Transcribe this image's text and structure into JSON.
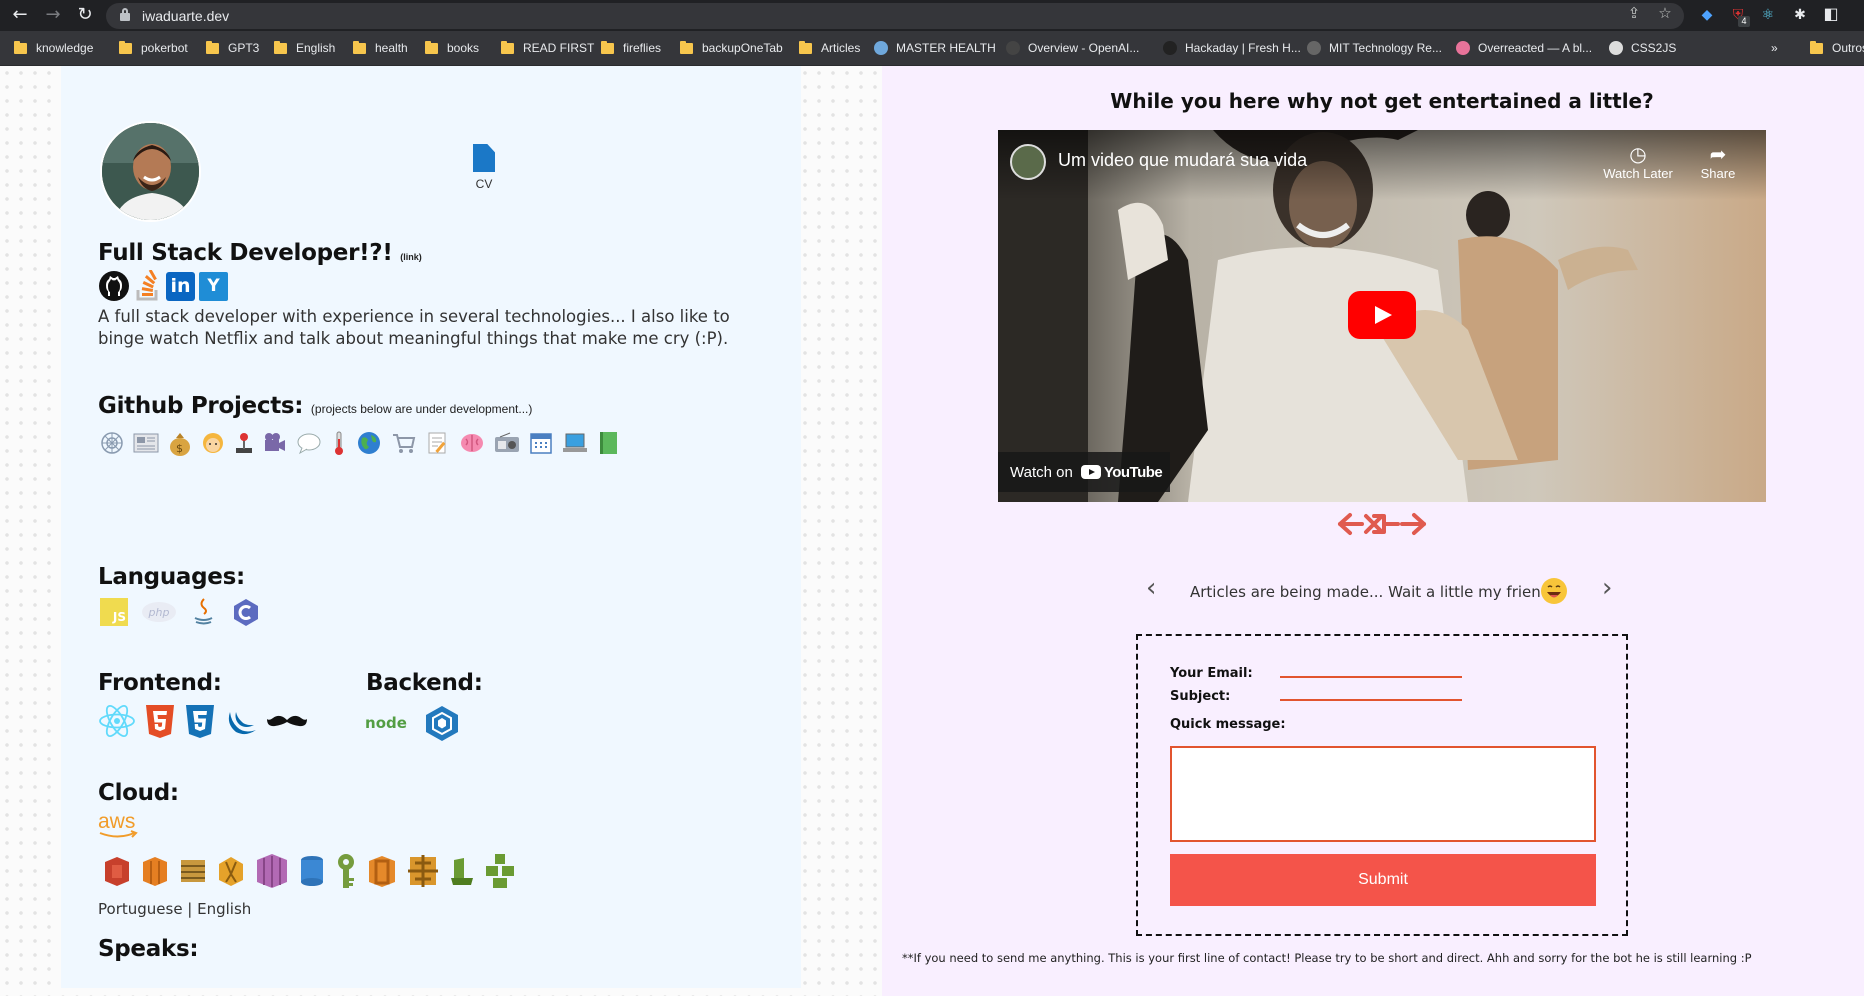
{
  "browser": {
    "url": "iwaduarte.dev",
    "bookmarks": [
      {
        "label": "knowledge",
        "type": "folder"
      },
      {
        "label": "pokerbot",
        "type": "folder"
      },
      {
        "label": "GPT3",
        "type": "folder"
      },
      {
        "label": "English",
        "type": "folder"
      },
      {
        "label": "health",
        "type": "folder"
      },
      {
        "label": "books",
        "type": "folder"
      },
      {
        "label": "READ FIRST",
        "type": "folder"
      },
      {
        "label": "fireflies",
        "type": "folder"
      },
      {
        "label": "backupOneTab",
        "type": "folder"
      },
      {
        "label": "Articles",
        "type": "folder"
      },
      {
        "label": "MASTER HEALTH",
        "type": "site",
        "color": "#6fa8dc"
      },
      {
        "label": "Overview - OpenAI...",
        "type": "site",
        "color": "#444444"
      },
      {
        "label": "Hackaday | Fresh H...",
        "type": "site",
        "color": "#222222"
      },
      {
        "label": "MIT Technology Re...",
        "type": "site",
        "color": "#666666"
      },
      {
        "label": "Overreacted — A bl...",
        "type": "site",
        "color": "#e8739a"
      },
      {
        "label": "CSS2JS",
        "type": "site",
        "color": "#dddddd"
      }
    ],
    "more_label": "»",
    "other_bookmarks": "Outros",
    "extension_badge": "4"
  },
  "profile": {
    "cv_label": "CV",
    "title": "Full Stack Developer!?!",
    "title_note": "(link)",
    "bio": "A full stack developer with experience in several technologies... I also like to binge watch Netflix and talk about meaningful things that make me cry (:P).",
    "social_icons": [
      "github-icon",
      "stackoverflow-icon",
      "linkedin-icon",
      "yammer-icon"
    ]
  },
  "sections": {
    "github_title": "Github Projects:",
    "github_note": "(projects below are under development...)",
    "languages_title": "Languages:",
    "frontend_title": "Frontend:",
    "backend_title": "Backend:",
    "cloud_title": "Cloud:",
    "cloud_brand": "aws",
    "speaks_title": "Speaks:",
    "speaks_text": "Portuguese | English"
  },
  "languages": {
    "js_badge": "JS",
    "php_badge": "php"
  },
  "backend": {
    "node_badge": "node"
  },
  "entertainment": {
    "title": "While you here why not get entertained a little?",
    "video_title": "Um video que mudará sua vida",
    "watch_later": "Watch Later",
    "share": "Share",
    "watch_on": "Watch on",
    "youtube": "YouTube"
  },
  "articles": {
    "text": "Articles are being made... Wait a little my friend."
  },
  "contact": {
    "email_label": "Your Email:",
    "subject_label": "Subject:",
    "message_label": "Quick message:",
    "submit_label": "Submit",
    "footnote": "**If you need to send me anything. This is your first line of contact! Please try to be short and direct. Ahh and sorry for the bot he is still learning :P"
  }
}
